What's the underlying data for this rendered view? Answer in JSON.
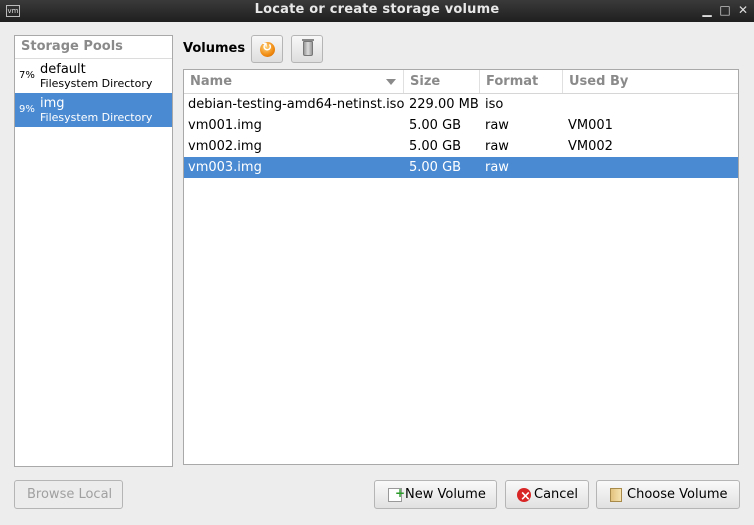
{
  "window": {
    "title": "Locate or create storage volume"
  },
  "pools": {
    "header": "Storage Pools",
    "items": [
      {
        "pct": "7%",
        "name": "default",
        "type": "Filesystem Directory"
      },
      {
        "pct": "9%",
        "name": "img",
        "type": "Filesystem Directory"
      }
    ],
    "selected_index": 1
  },
  "volumes": {
    "label": "Volumes",
    "columns": [
      "Name",
      "Size",
      "Format",
      "Used By"
    ],
    "rows": [
      {
        "name": "debian-testing-amd64-netinst.iso",
        "size": "229.00 MB",
        "format": "iso",
        "used_by": ""
      },
      {
        "name": "vm001.img",
        "size": "5.00 GB",
        "format": "raw",
        "used_by": "VM001"
      },
      {
        "name": "vm002.img",
        "size": "5.00 GB",
        "format": "raw",
        "used_by": "VM002"
      },
      {
        "name": "vm003.img",
        "size": "5.00 GB",
        "format": "raw",
        "used_by": ""
      }
    ],
    "selected_index": 3
  },
  "buttons": {
    "browse_local": "Browse Local",
    "new_volume": "New Volume",
    "cancel": "Cancel",
    "choose_volume": "Choose Volume"
  },
  "colors": {
    "selection": "#4a8ad2"
  }
}
